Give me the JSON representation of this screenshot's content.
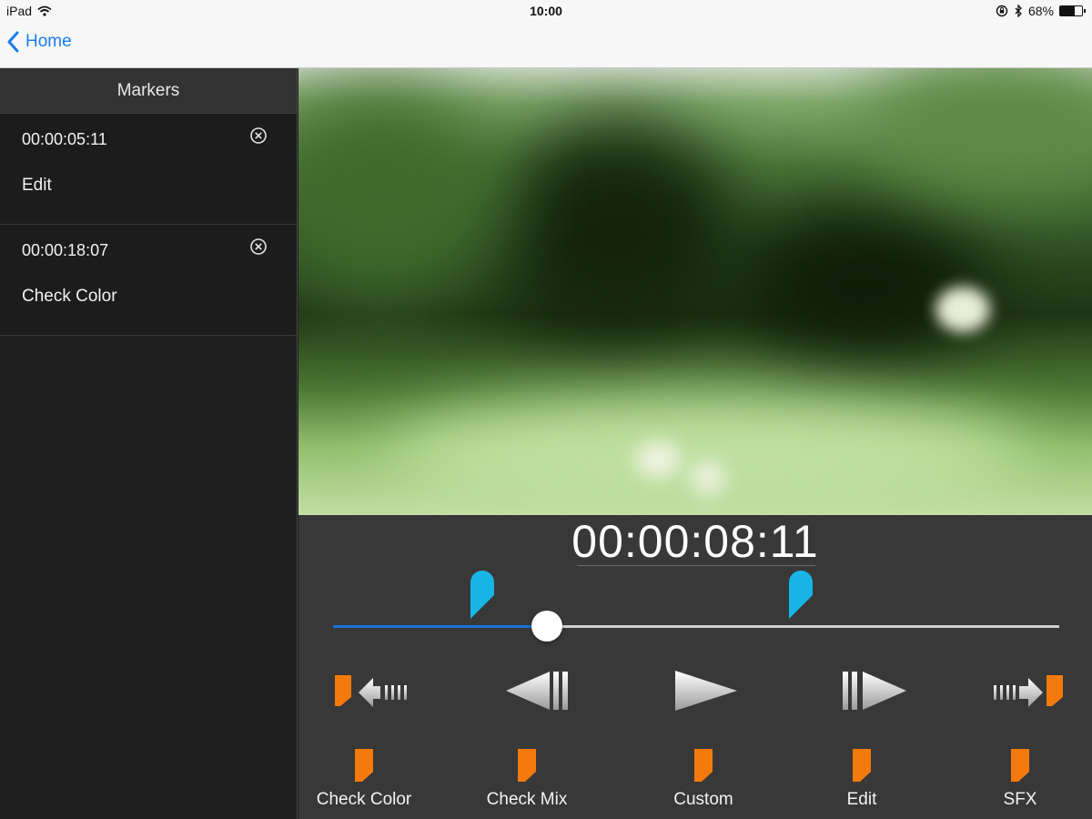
{
  "status": {
    "device": "iPad",
    "time": "10:00",
    "battery": "68%",
    "battery_level": 0.68
  },
  "nav": {
    "back_label": "Home"
  },
  "sidebar": {
    "title": "Markers",
    "markers": [
      {
        "time": "00:00:05:11",
        "label": "Edit"
      },
      {
        "time": "00:00:18:07",
        "label": "Check Color"
      }
    ]
  },
  "player": {
    "timecode": "00:00:08:11",
    "progress": 0.295,
    "marker_positions": [
      0.205,
      0.644
    ]
  },
  "presets": [
    {
      "label": "Check Color"
    },
    {
      "label": "Check Mix"
    },
    {
      "label": "Custom"
    },
    {
      "label": "Edit"
    },
    {
      "label": "SFX"
    }
  ],
  "colors": {
    "accent": "#1a7cf0",
    "marker_pin": "#17b5e6",
    "flag": "#f57a0c",
    "progress": "#1e6fd9"
  },
  "icons": [
    "wifi-icon",
    "bluetooth-icon",
    "rotation-lock-icon",
    "battery-icon",
    "chevron-left-icon",
    "close-circle-icon",
    "previous-marker-icon",
    "step-back-icon",
    "play-icon",
    "step-forward-icon",
    "next-marker-icon",
    "marker-pin-icon",
    "flag-icon"
  ]
}
